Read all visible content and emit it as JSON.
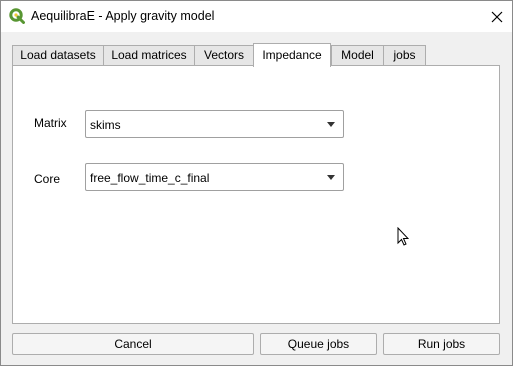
{
  "window": {
    "title": "AequilibraE - Apply gravity model",
    "icon": "qgis-icon",
    "close_icon": "close-icon"
  },
  "tabs": [
    {
      "label": "Load datasets",
      "active": false
    },
    {
      "label": "Load matrices",
      "active": false
    },
    {
      "label": "Vectors",
      "active": false
    },
    {
      "label": "Impedance",
      "active": true
    },
    {
      "label": "Model",
      "active": false
    },
    {
      "label": "jobs",
      "active": false
    }
  ],
  "impedance": {
    "matrix_label": "Matrix",
    "matrix_value": "skims",
    "core_label": "Core",
    "core_value": "free_flow_time_c_final"
  },
  "buttons": {
    "cancel": "Cancel",
    "queue": "Queue jobs",
    "run": "Run jobs"
  },
  "colors": {
    "qgis_green": "#589632",
    "qgis_yellow": "#f0c930"
  }
}
